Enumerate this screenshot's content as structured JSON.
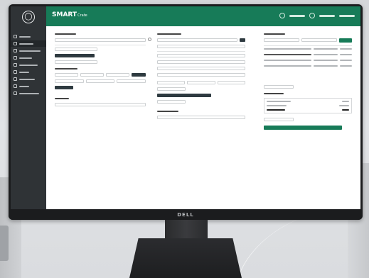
{
  "app": {
    "title": "SMART",
    "title_suffix": "Crate"
  },
  "monitor": {
    "brand": "DELL"
  },
  "colors": {
    "accent": "#177b58",
    "sidebar": "#2f3336",
    "content_bg": "#ffffff"
  },
  "sidebar": {
    "active_index": 1,
    "item_count": 9
  },
  "icons": {
    "brand_badge": "brand-badge-icon",
    "header": [
      "refresh-icon",
      "user-icon",
      "settings-icon",
      "logout-icon"
    ]
  }
}
